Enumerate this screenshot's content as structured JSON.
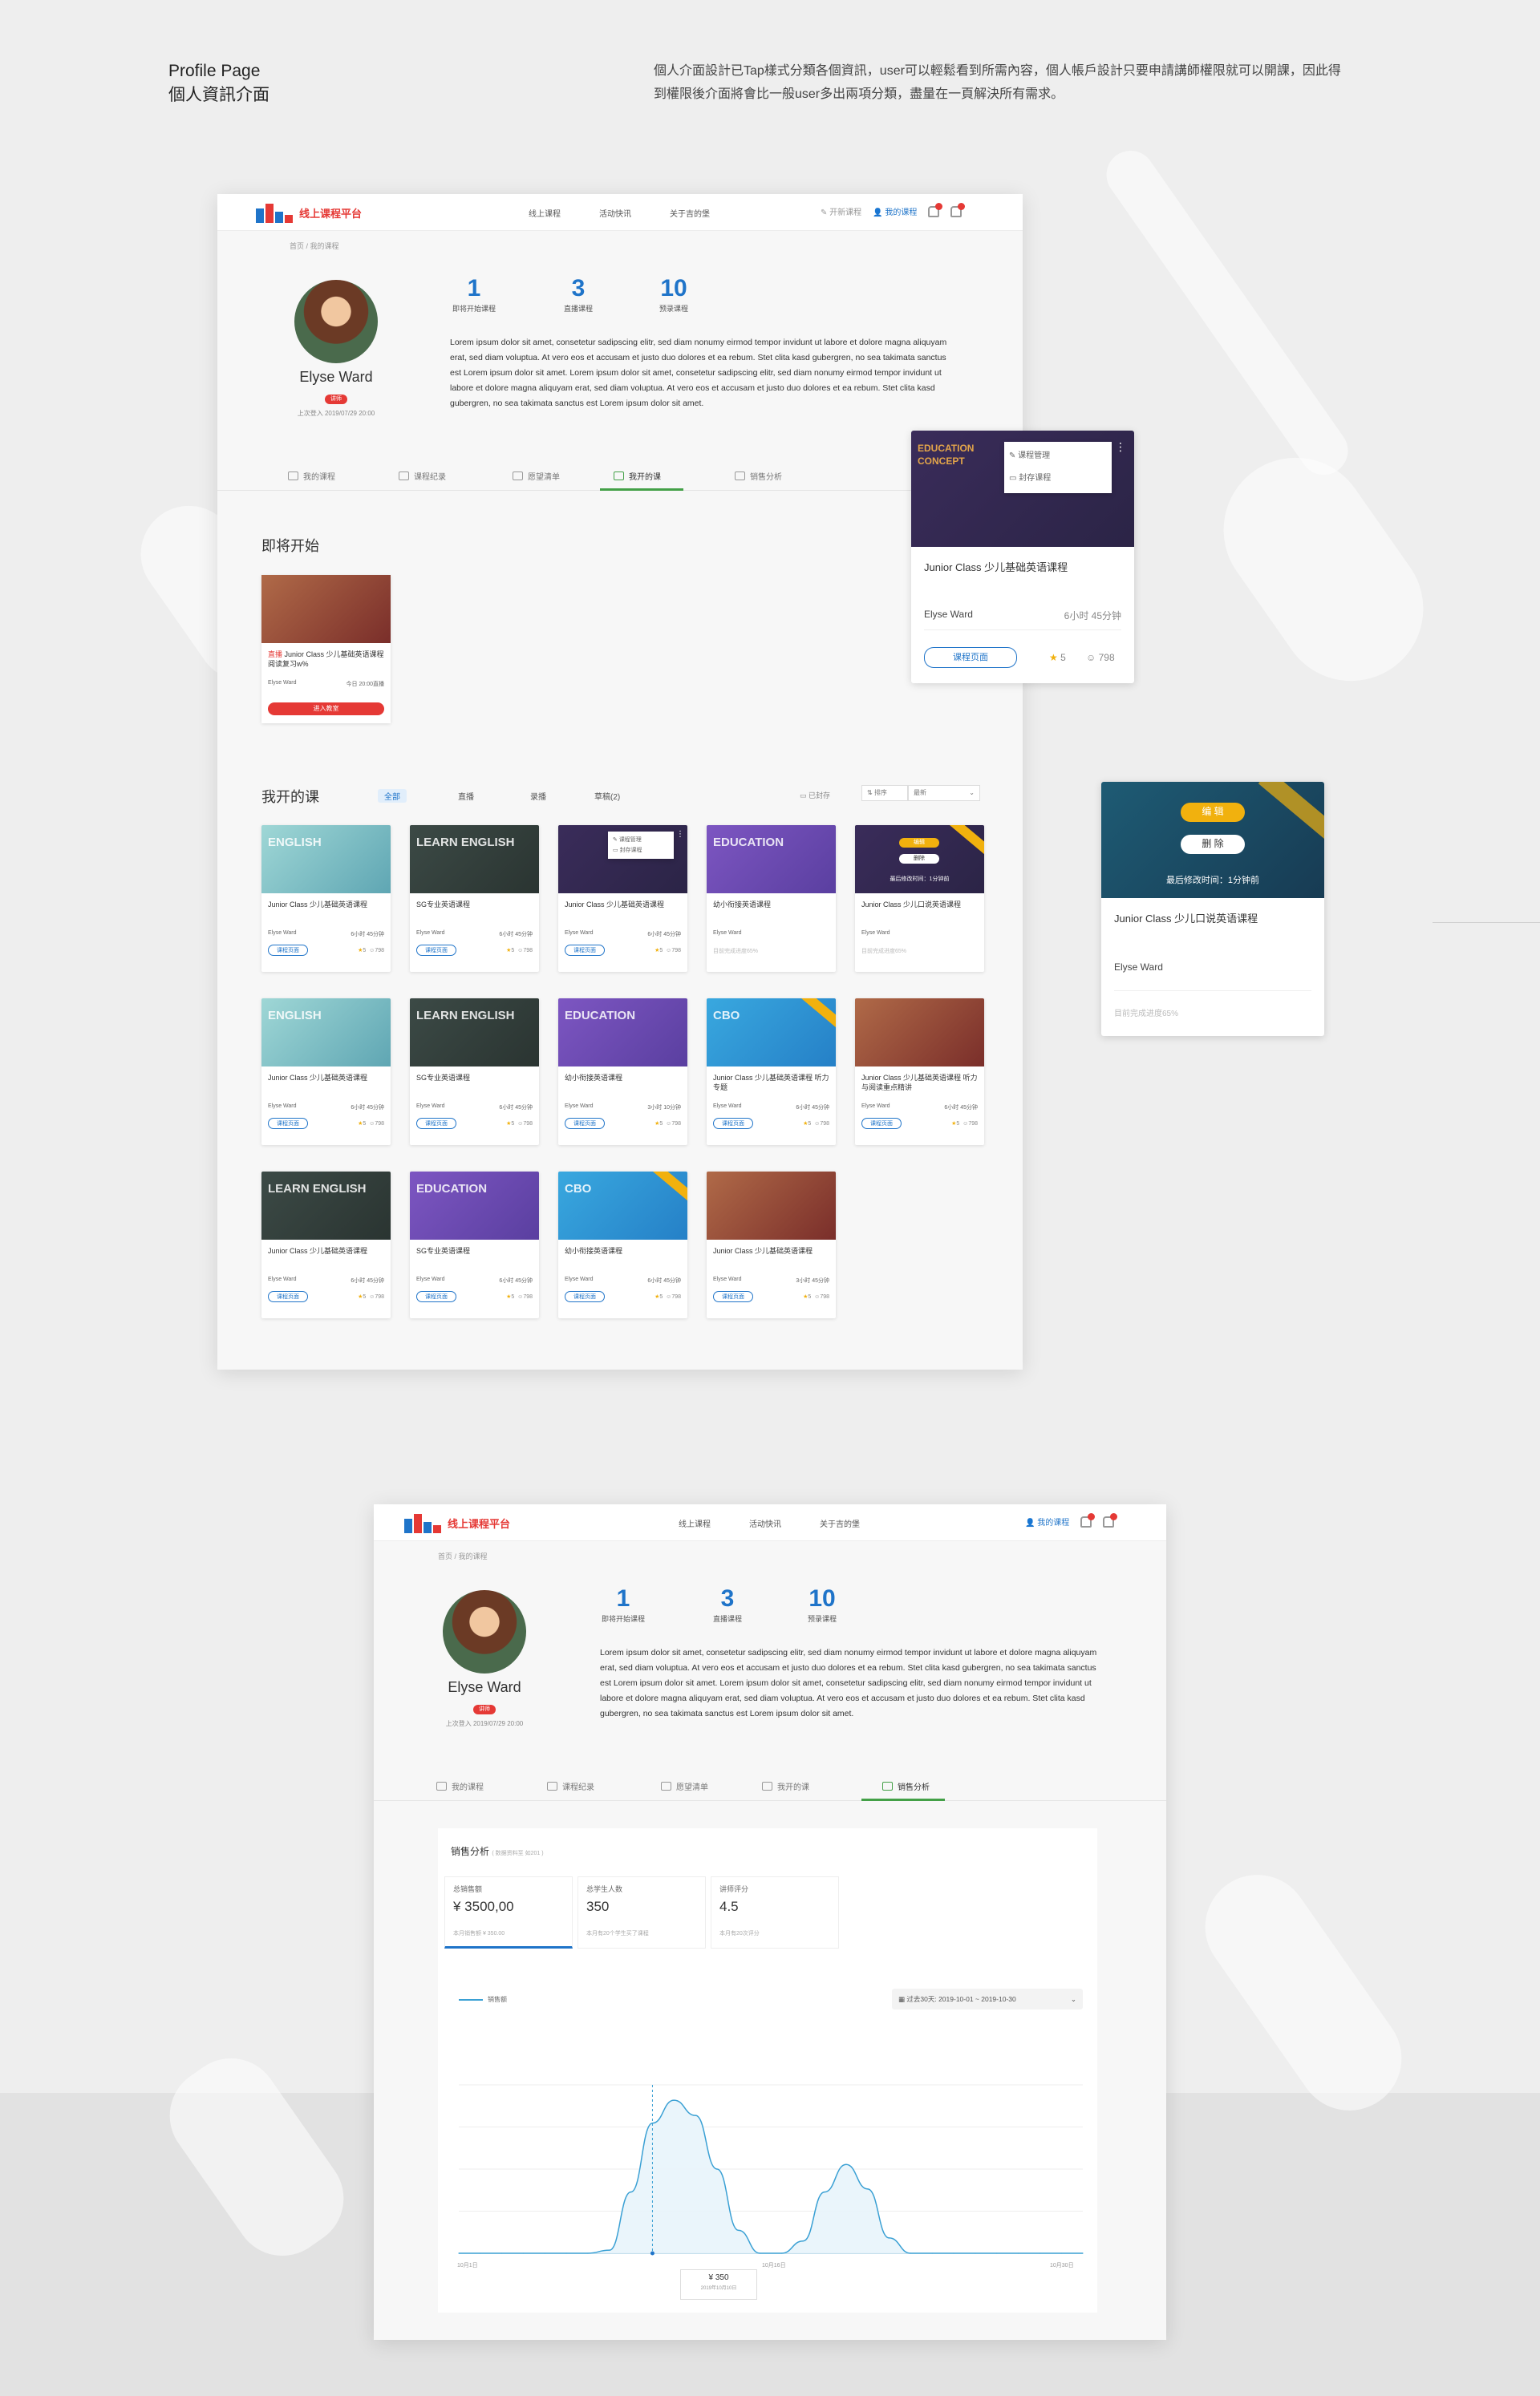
{
  "intro": {
    "title_en": "Profile Page",
    "title_zh": "個人資訊介面",
    "description": "個人介面設計已Tap樣式分類各個資訊，user可以輕鬆看到所需內容，個人帳戶設計只要申請講師權限就可以開課，因此得到權限後介面將會比一般user多出兩項分類，盡量在一頁解決所有需求。"
  },
  "nav": {
    "logo": "线上课程平台",
    "links": [
      "线上课程",
      "活动快讯",
      "关于吉的堡"
    ],
    "open_course": "开新课程",
    "my_course": "我的课程",
    "bell_count": "1",
    "cart_count": "0"
  },
  "breadcrumb": [
    "首页",
    "我的课程"
  ],
  "profile": {
    "name": "Elyse Ward",
    "badge": "讲师",
    "last_login": "上次登入 2019/07/29 20:00",
    "stats": [
      {
        "value": "1",
        "label": "即将开始课程"
      },
      {
        "value": "3",
        "label": "直播课程"
      },
      {
        "value": "10",
        "label": "预录课程"
      }
    ],
    "bio": "Lorem ipsum dolor sit amet, consetetur sadipscing elitr, sed diam nonumy eirmod tempor invidunt ut labore et dolore magna aliquyam erat, sed diam voluptua. At vero eos et accusam et justo duo dolores et ea rebum. Stet clita kasd gubergren, no sea takimata sanctus est Lorem ipsum dolor sit amet. Lorem ipsum dolor sit amet, consetetur sadipscing elitr, sed diam nonumy eirmod tempor invidunt ut labore et dolore magna aliquyam erat, sed diam voluptua. At vero eos et accusam et justo duo dolores et ea rebum. Stet clita kasd gubergren, no sea takimata sanctus est Lorem ipsum dolor sit amet."
  },
  "tabs": [
    "我的课程",
    "课程纪录",
    "愿望清单",
    "我开的课",
    "销售分析"
  ],
  "upcoming": {
    "title": "即将开始",
    "card": {
      "tag": "直播",
      "title": "Junior Class 少儿基础英语课程 阅读复习w%",
      "author": "Elyse Ward",
      "time": "今日 20:00直播",
      "button": "进入教室"
    }
  },
  "my_courses": {
    "title": "我开的课",
    "filters": [
      "全部",
      "直播",
      "录播",
      "草稿(2)"
    ],
    "archived": "已封存",
    "sort_label": "排序",
    "sort_value": "最新",
    "rows": [
      [
        {
          "theme": "sky",
          "thumb": "ENGLISH",
          "title": "Junior Class 少儿基础英语课程",
          "author": "Elyse Ward",
          "duration": "6小时 45分钟",
          "rating": "5",
          "students": "798",
          "button": "课程页面"
        },
        {
          "theme": "board",
          "thumb": "LEARN ENGLISH",
          "title": "SG专业英语课程",
          "author": "Elyse Ward",
          "duration": "6小时 45分钟",
          "rating": "5",
          "students": "798",
          "button": "课程页面"
        },
        {
          "theme": "dark",
          "thumb": "",
          "title": "Junior Class 少儿基础英语课程",
          "author": "Elyse Ward",
          "duration": "6小时 45分钟",
          "rating": "5",
          "students": "798",
          "button": "课程页面",
          "menu": [
            "课程管理",
            "封存课程"
          ]
        },
        {
          "theme": "purple",
          "thumb": "EDUCATION",
          "title": "幼小衔接英语课程",
          "author": "Elyse Ward",
          "progress": "目前完成进度65%"
        },
        {
          "theme": "dark",
          "thumb": "",
          "title": "Junior Class 少儿口说英语课程",
          "author": "Elyse Ward",
          "progress": "目前完成进度65%",
          "overlay": [
            "编辑",
            "删除",
            "最后修改时间：1分钟前"
          ]
        }
      ],
      [
        {
          "theme": "sky",
          "thumb": "ENGLISH",
          "title": "Junior Class 少儿基础英语课程",
          "author": "Elyse Ward",
          "duration": "6小时 45分钟",
          "rating": "5",
          "students": "798",
          "button": "课程页面"
        },
        {
          "theme": "board",
          "thumb": "LEARN ENGLISH",
          "title": "SG专业英语课程",
          "author": "Elyse Ward",
          "duration": "6小时 45分钟",
          "rating": "5",
          "students": "798",
          "button": "课程页面"
        },
        {
          "theme": "purple",
          "thumb": "EDUCATION",
          "title": "幼小衔接英语课程",
          "author": "Elyse Ward",
          "duration": "3小时 10分钟",
          "rating": "5",
          "students": "798",
          "button": "课程页面"
        },
        {
          "theme": "blue",
          "thumb": "CBO",
          "title": "Junior Class 少儿基础英语课程 听力专题",
          "author": "Elyse Ward",
          "duration": "6小时 45分钟",
          "rating": "5",
          "students": "798",
          "button": "课程页面"
        },
        {
          "theme": "class",
          "thumb": "",
          "title": "Junior Class 少儿基础英语课程 听力与阅读重点精讲",
          "author": "Elyse Ward",
          "duration": "6小时 45分钟",
          "rating": "5",
          "students": "798",
          "button": "课程页面"
        }
      ],
      [
        {
          "theme": "board",
          "thumb": "LEARN ENGLISH",
          "title": "Junior Class 少儿基础英语课程",
          "author": "Elyse Ward",
          "duration": "6小时 45分钟",
          "rating": "5",
          "students": "798",
          "button": "课程页面"
        },
        {
          "theme": "purple",
          "thumb": "EDUCATION",
          "title": "SG专业英语课程",
          "author": "Elyse Ward",
          "duration": "6小时 45分钟",
          "rating": "5",
          "students": "798",
          "button": "课程页面"
        },
        {
          "theme": "blue",
          "thumb": "CBO",
          "title": "幼小衔接英语课程",
          "author": "Elyse Ward",
          "duration": "6小时 45分钟",
          "rating": "5",
          "students": "798",
          "button": "课程页面"
        },
        {
          "theme": "class",
          "thumb": "",
          "title": "Junior Class 少儿基础英语课程",
          "author": "Elyse Ward",
          "duration": "3小时 45分钟",
          "rating": "5",
          "students": "798",
          "button": "课程页面"
        }
      ]
    ]
  },
  "popup_card": {
    "title": "Junior Class 少儿基础英语课程",
    "author": "Elyse Ward",
    "duration": "6小时 45分钟",
    "button": "课程页面",
    "rating": "5",
    "students": "798",
    "menu": [
      "课程管理",
      "封存课程"
    ]
  },
  "draft_card": {
    "title": "Junior Class 少儿口说英语课程",
    "author": "Elyse Ward",
    "edit": "编 辑",
    "delete": "删 除",
    "modified": "最后修改时间：1分钟前",
    "progress": "目前完成进度65%"
  },
  "sales": {
    "title": "销售分析",
    "note": "( 数据资料至 如201 )",
    "kpis": [
      {
        "label": "总销售额",
        "value": "¥ 3500,00",
        "sub": "本月销售额 ¥ 350.00"
      },
      {
        "label": "总学生人数",
        "value": "350",
        "sub": "本月有20个学生买了课程"
      },
      {
        "label": "讲师评分",
        "value": "4.5",
        "sub": "本月有20次评分"
      }
    ],
    "legend": "销售额",
    "range": "过去30天:  2019-10-01 ~ 2019-10-30",
    "x_ticks": [
      "10月1日",
      "10月16日",
      "10月30日"
    ],
    "tooltip_value": "¥ 350",
    "tooltip_date": "2019年10月10日"
  },
  "chart_data": {
    "type": "area",
    "title": "",
    "series": [
      {
        "name": "销售额",
        "values": [
          0,
          0,
          0,
          0,
          0,
          0,
          0,
          2,
          40,
          85,
          100,
          90,
          55,
          15,
          0,
          0,
          8,
          40,
          58,
          42,
          10,
          0,
          0,
          0,
          0,
          0,
          0,
          0,
          0,
          0
        ]
      }
    ],
    "x": [
      "10月1日",
      "10月2日",
      "10月3日",
      "10月4日",
      "10月5日",
      "10月6日",
      "10月7日",
      "10月8日",
      "10月9日",
      "10月10日",
      "10月11日",
      "10月12日",
      "10月13日",
      "10月14日",
      "10月15日",
      "10月16日",
      "10月17日",
      "10月18日",
      "10月19日",
      "10月20日",
      "10月21日",
      "10月22日",
      "10月23日",
      "10月24日",
      "10月25日",
      "10月26日",
      "10月27日",
      "10月28日",
      "10月29日",
      "10月30日"
    ],
    "grid": true,
    "legend": "top-left",
    "highlight": {
      "x": "10月10日",
      "label": "¥ 350"
    }
  }
}
